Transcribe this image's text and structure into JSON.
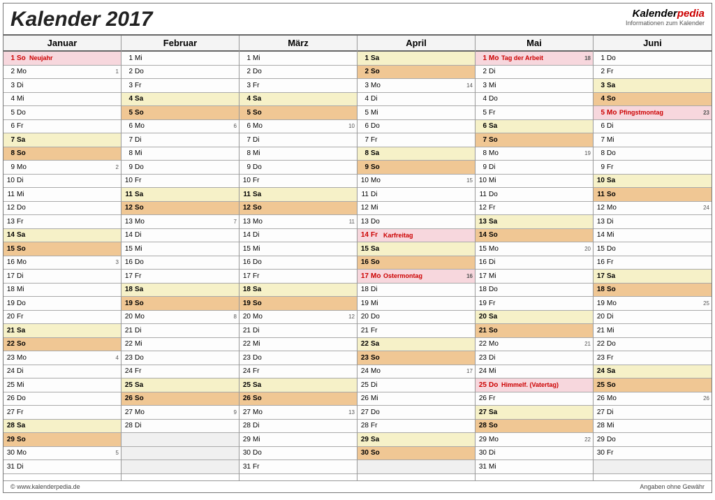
{
  "title": "Kalender 2017",
  "brand": {
    "part1": "Kalender",
    "part2": "pedia",
    "tagline": "Informationen zum Kalender"
  },
  "footer": {
    "left": "© www.kalenderpedia.de",
    "right": "Angaben ohne Gewähr"
  },
  "months": [
    {
      "name": "Januar",
      "days": [
        {
          "d": 1,
          "w": "So",
          "t": "sun",
          "hol": "Neujahr",
          "holiday": true
        },
        {
          "d": 2,
          "w": "Mo",
          "wk": 1
        },
        {
          "d": 3,
          "w": "Di"
        },
        {
          "d": 4,
          "w": "Mi"
        },
        {
          "d": 5,
          "w": "Do"
        },
        {
          "d": 6,
          "w": "Fr"
        },
        {
          "d": 7,
          "w": "Sa",
          "t": "sat"
        },
        {
          "d": 8,
          "w": "So",
          "t": "sun"
        },
        {
          "d": 9,
          "w": "Mo",
          "wk": 2
        },
        {
          "d": 10,
          "w": "Di"
        },
        {
          "d": 11,
          "w": "Mi"
        },
        {
          "d": 12,
          "w": "Do"
        },
        {
          "d": 13,
          "w": "Fr"
        },
        {
          "d": 14,
          "w": "Sa",
          "t": "sat"
        },
        {
          "d": 15,
          "w": "So",
          "t": "sun"
        },
        {
          "d": 16,
          "w": "Mo",
          "wk": 3
        },
        {
          "d": 17,
          "w": "Di"
        },
        {
          "d": 18,
          "w": "Mi"
        },
        {
          "d": 19,
          "w": "Do"
        },
        {
          "d": 20,
          "w": "Fr"
        },
        {
          "d": 21,
          "w": "Sa",
          "t": "sat"
        },
        {
          "d": 22,
          "w": "So",
          "t": "sun"
        },
        {
          "d": 23,
          "w": "Mo",
          "wk": 4
        },
        {
          "d": 24,
          "w": "Di"
        },
        {
          "d": 25,
          "w": "Mi"
        },
        {
          "d": 26,
          "w": "Do"
        },
        {
          "d": 27,
          "w": "Fr"
        },
        {
          "d": 28,
          "w": "Sa",
          "t": "sat"
        },
        {
          "d": 29,
          "w": "So",
          "t": "sun"
        },
        {
          "d": 30,
          "w": "Mo",
          "wk": 5
        },
        {
          "d": 31,
          "w": "Di"
        }
      ]
    },
    {
      "name": "Februar",
      "days": [
        {
          "d": 1,
          "w": "Mi"
        },
        {
          "d": 2,
          "w": "Do"
        },
        {
          "d": 3,
          "w": "Fr"
        },
        {
          "d": 4,
          "w": "Sa",
          "t": "sat"
        },
        {
          "d": 5,
          "w": "So",
          "t": "sun"
        },
        {
          "d": 6,
          "w": "Mo",
          "wk": 6
        },
        {
          "d": 7,
          "w": "Di"
        },
        {
          "d": 8,
          "w": "Mi"
        },
        {
          "d": 9,
          "w": "Do"
        },
        {
          "d": 10,
          "w": "Fr"
        },
        {
          "d": 11,
          "w": "Sa",
          "t": "sat"
        },
        {
          "d": 12,
          "w": "So",
          "t": "sun"
        },
        {
          "d": 13,
          "w": "Mo",
          "wk": 7
        },
        {
          "d": 14,
          "w": "Di"
        },
        {
          "d": 15,
          "w": "Mi"
        },
        {
          "d": 16,
          "w": "Do"
        },
        {
          "d": 17,
          "w": "Fr"
        },
        {
          "d": 18,
          "w": "Sa",
          "t": "sat"
        },
        {
          "d": 19,
          "w": "So",
          "t": "sun"
        },
        {
          "d": 20,
          "w": "Mo",
          "wk": 8
        },
        {
          "d": 21,
          "w": "Di"
        },
        {
          "d": 22,
          "w": "Mi"
        },
        {
          "d": 23,
          "w": "Do"
        },
        {
          "d": 24,
          "w": "Fr"
        },
        {
          "d": 25,
          "w": "Sa",
          "t": "sat"
        },
        {
          "d": 26,
          "w": "So",
          "t": "sun"
        },
        {
          "d": 27,
          "w": "Mo",
          "wk": 9
        },
        {
          "d": 28,
          "w": "Di"
        },
        {
          "empty": true
        },
        {
          "empty": true
        },
        {
          "empty": true
        }
      ]
    },
    {
      "name": "März",
      "days": [
        {
          "d": 1,
          "w": "Mi"
        },
        {
          "d": 2,
          "w": "Do"
        },
        {
          "d": 3,
          "w": "Fr"
        },
        {
          "d": 4,
          "w": "Sa",
          "t": "sat"
        },
        {
          "d": 5,
          "w": "So",
          "t": "sun"
        },
        {
          "d": 6,
          "w": "Mo",
          "wk": 10
        },
        {
          "d": 7,
          "w": "Di"
        },
        {
          "d": 8,
          "w": "Mi"
        },
        {
          "d": 9,
          "w": "Do"
        },
        {
          "d": 10,
          "w": "Fr"
        },
        {
          "d": 11,
          "w": "Sa",
          "t": "sat"
        },
        {
          "d": 12,
          "w": "So",
          "t": "sun"
        },
        {
          "d": 13,
          "w": "Mo",
          "wk": 11
        },
        {
          "d": 14,
          "w": "Di"
        },
        {
          "d": 15,
          "w": "Mi"
        },
        {
          "d": 16,
          "w": "Do"
        },
        {
          "d": 17,
          "w": "Fr"
        },
        {
          "d": 18,
          "w": "Sa",
          "t": "sat"
        },
        {
          "d": 19,
          "w": "So",
          "t": "sun"
        },
        {
          "d": 20,
          "w": "Mo",
          "wk": 12
        },
        {
          "d": 21,
          "w": "Di"
        },
        {
          "d": 22,
          "w": "Mi"
        },
        {
          "d": 23,
          "w": "Do"
        },
        {
          "d": 24,
          "w": "Fr"
        },
        {
          "d": 25,
          "w": "Sa",
          "t": "sat"
        },
        {
          "d": 26,
          "w": "So",
          "t": "sun"
        },
        {
          "d": 27,
          "w": "Mo",
          "wk": 13
        },
        {
          "d": 28,
          "w": "Di"
        },
        {
          "d": 29,
          "w": "Mi"
        },
        {
          "d": 30,
          "w": "Do"
        },
        {
          "d": 31,
          "w": "Fr"
        }
      ]
    },
    {
      "name": "April",
      "days": [
        {
          "d": 1,
          "w": "Sa",
          "t": "sat"
        },
        {
          "d": 2,
          "w": "So",
          "t": "sun"
        },
        {
          "d": 3,
          "w": "Mo",
          "wk": 14
        },
        {
          "d": 4,
          "w": "Di"
        },
        {
          "d": 5,
          "w": "Mi"
        },
        {
          "d": 6,
          "w": "Do"
        },
        {
          "d": 7,
          "w": "Fr"
        },
        {
          "d": 8,
          "w": "Sa",
          "t": "sat"
        },
        {
          "d": 9,
          "w": "So",
          "t": "sun"
        },
        {
          "d": 10,
          "w": "Mo",
          "wk": 15
        },
        {
          "d": 11,
          "w": "Di"
        },
        {
          "d": 12,
          "w": "Mi"
        },
        {
          "d": 13,
          "w": "Do"
        },
        {
          "d": 14,
          "w": "Fr",
          "hol": "Karfreitag",
          "holiday": true
        },
        {
          "d": 15,
          "w": "Sa",
          "t": "sat"
        },
        {
          "d": 16,
          "w": "So",
          "t": "sun"
        },
        {
          "d": 17,
          "w": "Mo",
          "hol": "Ostermontag",
          "holiday": true,
          "wk": 16
        },
        {
          "d": 18,
          "w": "Di"
        },
        {
          "d": 19,
          "w": "Mi"
        },
        {
          "d": 20,
          "w": "Do"
        },
        {
          "d": 21,
          "w": "Fr"
        },
        {
          "d": 22,
          "w": "Sa",
          "t": "sat"
        },
        {
          "d": 23,
          "w": "So",
          "t": "sun"
        },
        {
          "d": 24,
          "w": "Mo",
          "wk": 17
        },
        {
          "d": 25,
          "w": "Di"
        },
        {
          "d": 26,
          "w": "Mi"
        },
        {
          "d": 27,
          "w": "Do"
        },
        {
          "d": 28,
          "w": "Fr"
        },
        {
          "d": 29,
          "w": "Sa",
          "t": "sat"
        },
        {
          "d": 30,
          "w": "So",
          "t": "sun"
        },
        {
          "empty": true
        }
      ]
    },
    {
      "name": "Mai",
      "days": [
        {
          "d": 1,
          "w": "Mo",
          "hol": "Tag der Arbeit",
          "holiday": true,
          "wk": 18
        },
        {
          "d": 2,
          "w": "Di"
        },
        {
          "d": 3,
          "w": "Mi"
        },
        {
          "d": 4,
          "w": "Do"
        },
        {
          "d": 5,
          "w": "Fr"
        },
        {
          "d": 6,
          "w": "Sa",
          "t": "sat"
        },
        {
          "d": 7,
          "w": "So",
          "t": "sun"
        },
        {
          "d": 8,
          "w": "Mo",
          "wk": 19
        },
        {
          "d": 9,
          "w": "Di"
        },
        {
          "d": 10,
          "w": "Mi"
        },
        {
          "d": 11,
          "w": "Do"
        },
        {
          "d": 12,
          "w": "Fr"
        },
        {
          "d": 13,
          "w": "Sa",
          "t": "sat"
        },
        {
          "d": 14,
          "w": "So",
          "t": "sun"
        },
        {
          "d": 15,
          "w": "Mo",
          "wk": 20
        },
        {
          "d": 16,
          "w": "Di"
        },
        {
          "d": 17,
          "w": "Mi"
        },
        {
          "d": 18,
          "w": "Do"
        },
        {
          "d": 19,
          "w": "Fr"
        },
        {
          "d": 20,
          "w": "Sa",
          "t": "sat"
        },
        {
          "d": 21,
          "w": "So",
          "t": "sun"
        },
        {
          "d": 22,
          "w": "Mo",
          "wk": 21
        },
        {
          "d": 23,
          "w": "Di"
        },
        {
          "d": 24,
          "w": "Mi"
        },
        {
          "d": 25,
          "w": "Do",
          "hol": "Himmelf. (Vatertag)",
          "holiday": true
        },
        {
          "d": 26,
          "w": "Fr"
        },
        {
          "d": 27,
          "w": "Sa",
          "t": "sat"
        },
        {
          "d": 28,
          "w": "So",
          "t": "sun"
        },
        {
          "d": 29,
          "w": "Mo",
          "wk": 22
        },
        {
          "d": 30,
          "w": "Di"
        },
        {
          "d": 31,
          "w": "Mi"
        }
      ]
    },
    {
      "name": "Juni",
      "days": [
        {
          "d": 1,
          "w": "Do"
        },
        {
          "d": 2,
          "w": "Fr"
        },
        {
          "d": 3,
          "w": "Sa",
          "t": "sat"
        },
        {
          "d": 4,
          "w": "So",
          "t": "sun"
        },
        {
          "d": 5,
          "w": "Mo",
          "hol": "Pfingstmontag",
          "holiday": true,
          "wk": 23
        },
        {
          "d": 6,
          "w": "Di"
        },
        {
          "d": 7,
          "w": "Mi"
        },
        {
          "d": 8,
          "w": "Do"
        },
        {
          "d": 9,
          "w": "Fr"
        },
        {
          "d": 10,
          "w": "Sa",
          "t": "sat"
        },
        {
          "d": 11,
          "w": "So",
          "t": "sun"
        },
        {
          "d": 12,
          "w": "Mo",
          "wk": 24
        },
        {
          "d": 13,
          "w": "Di"
        },
        {
          "d": 14,
          "w": "Mi"
        },
        {
          "d": 15,
          "w": "Do"
        },
        {
          "d": 16,
          "w": "Fr"
        },
        {
          "d": 17,
          "w": "Sa",
          "t": "sat"
        },
        {
          "d": 18,
          "w": "So",
          "t": "sun"
        },
        {
          "d": 19,
          "w": "Mo",
          "wk": 25
        },
        {
          "d": 20,
          "w": "Di"
        },
        {
          "d": 21,
          "w": "Mi"
        },
        {
          "d": 22,
          "w": "Do"
        },
        {
          "d": 23,
          "w": "Fr"
        },
        {
          "d": 24,
          "w": "Sa",
          "t": "sat"
        },
        {
          "d": 25,
          "w": "So",
          "t": "sun"
        },
        {
          "d": 26,
          "w": "Mo",
          "wk": 26
        },
        {
          "d": 27,
          "w": "Di"
        },
        {
          "d": 28,
          "w": "Mi"
        },
        {
          "d": 29,
          "w": "Do"
        },
        {
          "d": 30,
          "w": "Fr"
        },
        {
          "empty": true
        }
      ]
    }
  ]
}
